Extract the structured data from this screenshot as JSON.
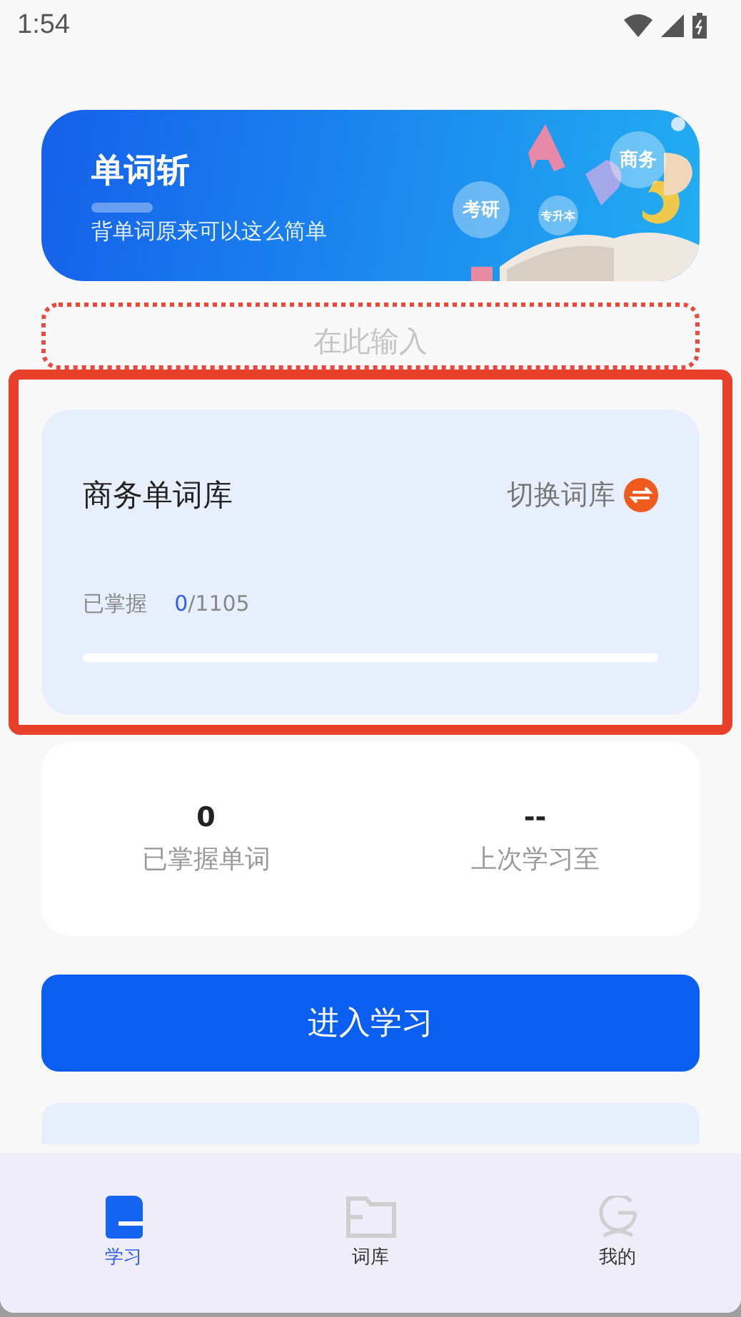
{
  "status_bar": {
    "time": "1:54"
  },
  "banner": {
    "title": "单词斩",
    "subtitle": "背单词原来可以这么简单",
    "tags": [
      "商务",
      "考研",
      "专升本"
    ]
  },
  "input": {
    "placeholder": "在此输入"
  },
  "library_card": {
    "name": "商务单词库",
    "switch_label": "切换词库",
    "progress_label": "已掌握",
    "mastered": "0",
    "total": "/1105",
    "level": 0
  },
  "stats": [
    {
      "value": "0",
      "label": "已掌握单词"
    },
    {
      "value": "--",
      "label": "上次学习至"
    }
  ],
  "primary_button": "进入学习",
  "tabs": [
    {
      "label": "学习",
      "kind": "study",
      "selected": true
    },
    {
      "label": "词库",
      "kind": "library",
      "selected": false
    },
    {
      "label": "我的",
      "kind": "profile",
      "selected": false
    }
  ]
}
